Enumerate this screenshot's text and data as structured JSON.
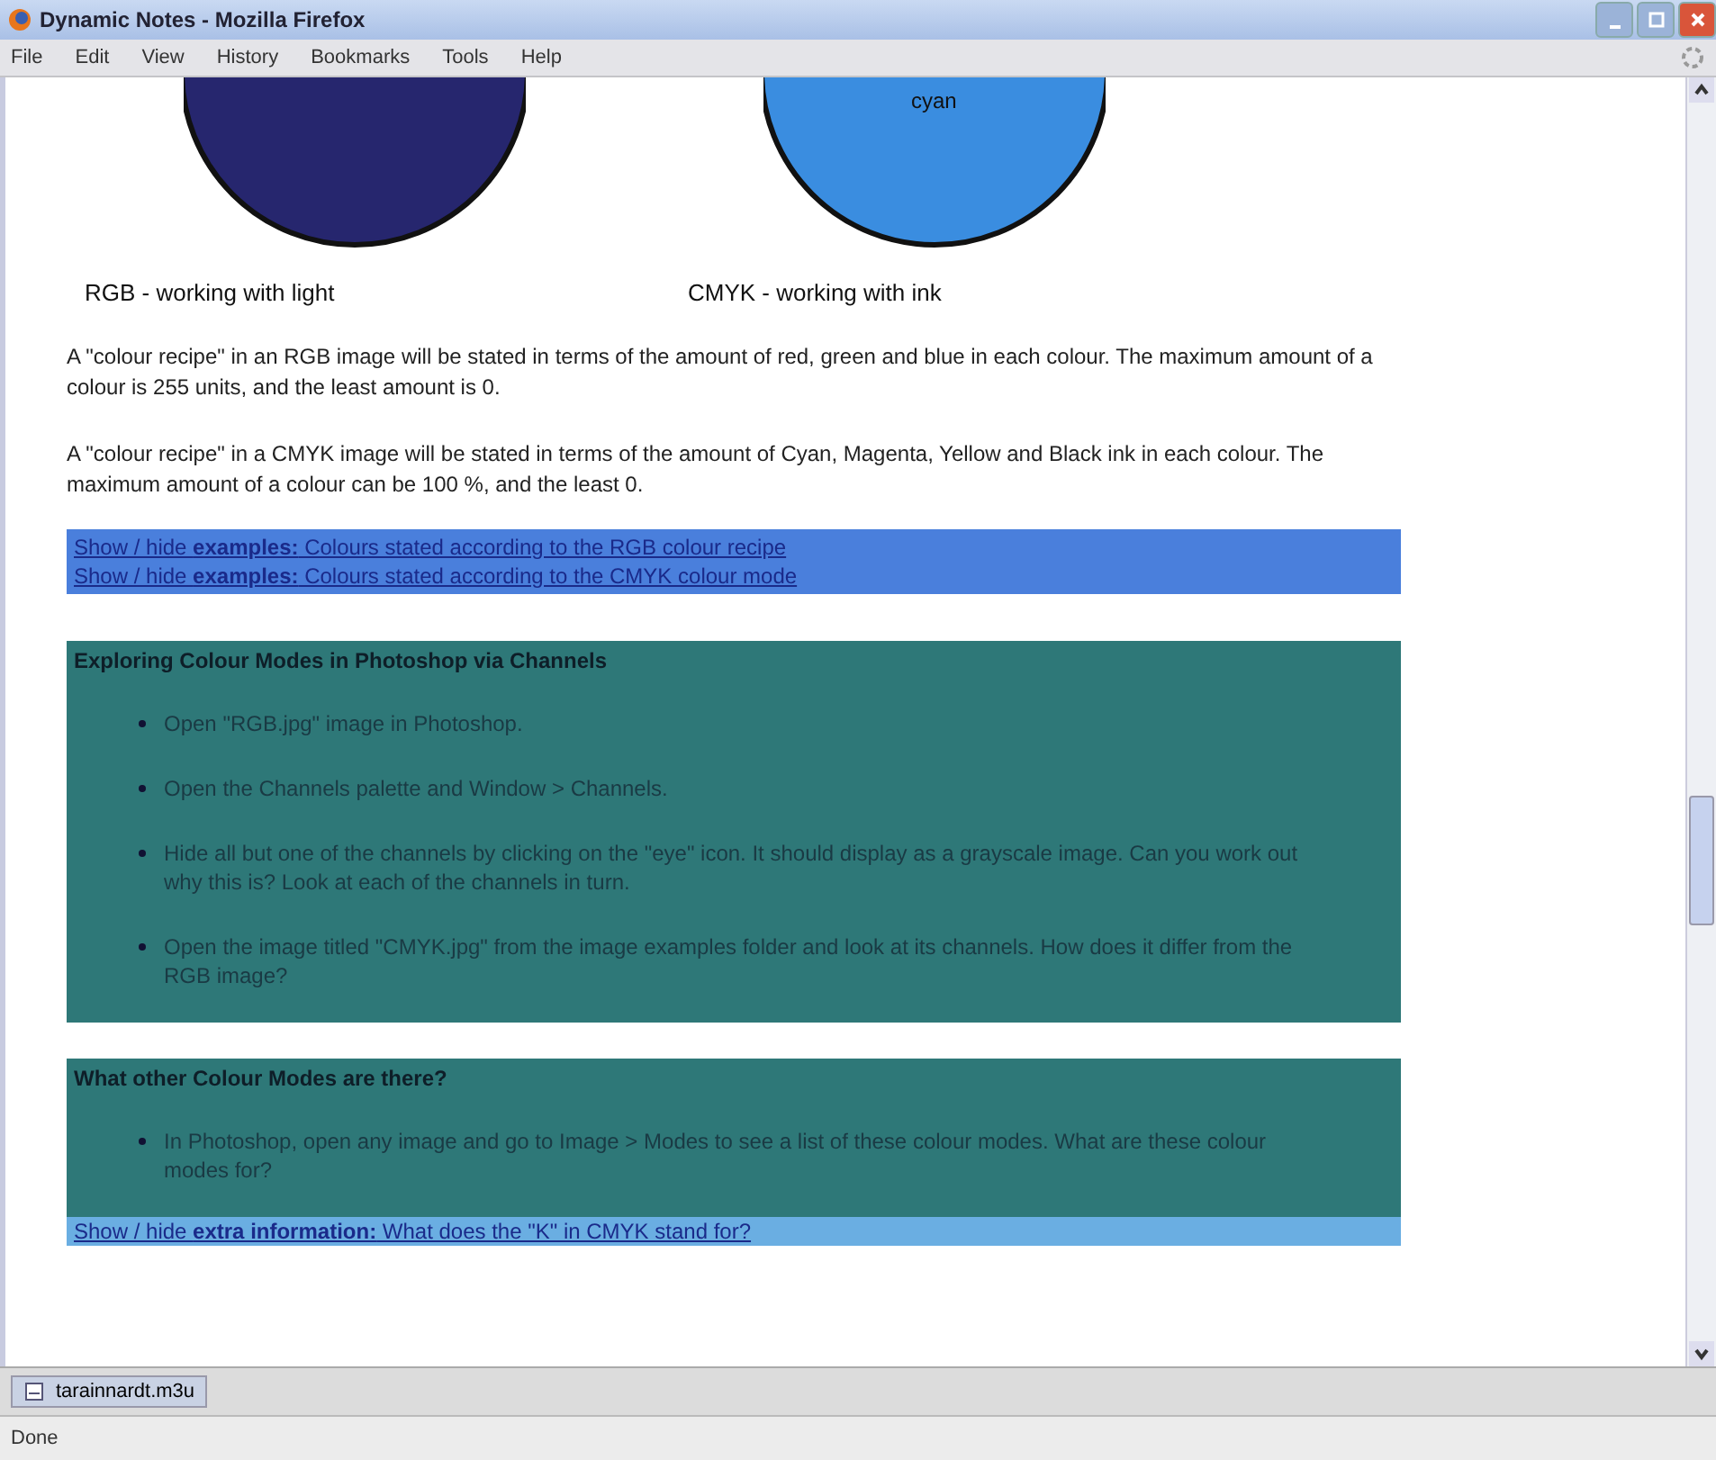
{
  "window": {
    "title": "Dynamic Notes - Mozilla Firefox"
  },
  "menu": [
    "File",
    "Edit",
    "View",
    "History",
    "Bookmarks",
    "Tools",
    "Help"
  ],
  "diagram": {
    "circle_label": "cyan",
    "captions": [
      "RGB - working with light",
      "CMYK - working with ink"
    ]
  },
  "paragraphs": [
    "A \"colour recipe\" in an RGB image will be stated in terms of the amount of red, green and blue in each colour. The maximum amount of a colour is 255 units, and the least amount is 0.",
    "A \"colour recipe\" in a CMYK image will be stated in terms of the amount of Cyan, Magenta, Yellow and Black ink in each colour. The maximum amount of a colour can be 100 %, and the least 0."
  ],
  "example_links": [
    "Show / hide **examples:** Colours stated according to the RGB colour recipe",
    "Show / hide **examples:** Colours stated according to the CMYK colour mode"
  ],
  "sections": [
    {
      "heading": "Exploring Colour Modes in Photoshop via Channels",
      "items": [
        "Open \"RGB.jpg\" image in Photoshop.",
        "Open the Channels palette and Window > Channels.",
        "Hide all but one of the channels by clicking on the \"eye\" icon. It should display as a grayscale image. Can you work out why this is? Look at each of the channels in turn.",
        "Open the image titled \"CMYK.jpg\" from the image examples folder and look at its channels. How does it differ from the RGB image?"
      ]
    },
    {
      "heading": "What other Colour Modes are there?",
      "items": [
        "In Photoshop, open any image and go to Image > Modes to see a list of these colour modes. What are these colour modes for?"
      ]
    }
  ],
  "extra_link": "Show / hide **extra information:** What does the \"K\" in CMYK stand for?",
  "download": {
    "file": "tarainnardt.m3u"
  },
  "status_bar": "Done"
}
